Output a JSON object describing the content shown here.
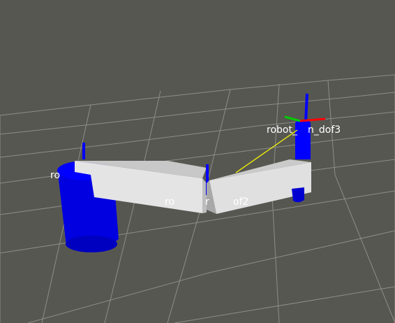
{
  "viewport": {
    "background": "#575752",
    "grid_color": "#a0a09c",
    "link_color": "#0000ff",
    "arm_color": "#d8d8d8",
    "axis_x_color": "#ff0000",
    "axis_y_color": "#00cc00",
    "axis_z_color": "#0000ff",
    "connector_color": "#ffff00"
  },
  "frame_labels": {
    "link1": "ro",
    "link2_a": "ro",
    "link2_b": "r",
    "link2_c": "of2",
    "link3_a": "robot_",
    "link3_b": "n_dof3"
  }
}
